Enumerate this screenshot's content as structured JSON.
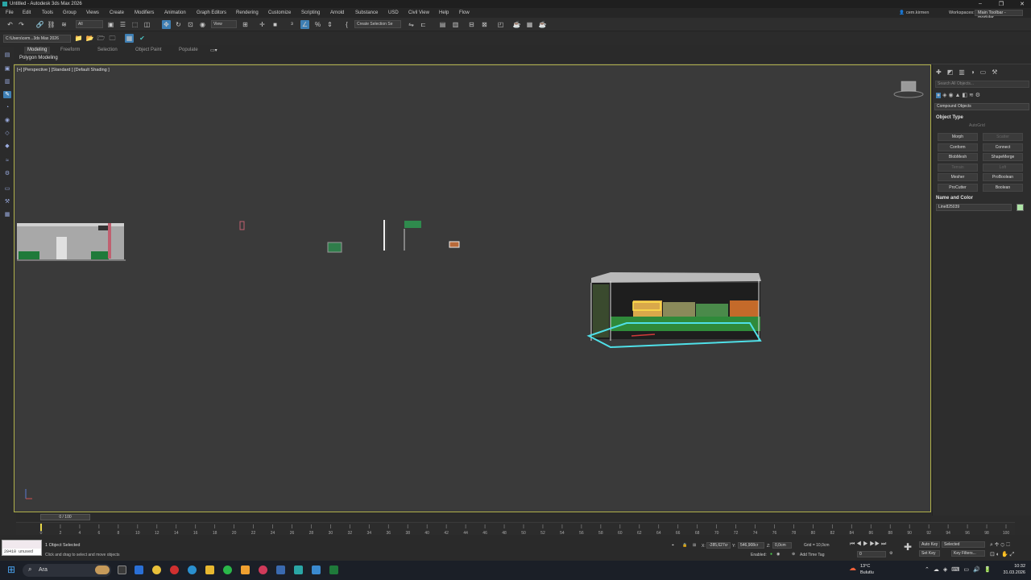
{
  "window": {
    "title": "Untitled - Autodesk 3ds Max 2026"
  },
  "menu": [
    "File",
    "Edit",
    "Tools",
    "Group",
    "Views",
    "Create",
    "Modifiers",
    "Animation",
    "Graph Editors",
    "Rendering",
    "Customize",
    "Scripting",
    "Arnold",
    "Substance",
    "USD",
    "Civil View",
    "Help",
    "Flow"
  ],
  "user": "cem.kirmen",
  "workspaces_label": "Workspaces:",
  "workspace_value": "Main Toolbar - modular",
  "toolbar": {
    "selection_filter": "All",
    "ref_coord": "View",
    "named_selection": "Create Selection Se"
  },
  "project_path": "C:\\Users\\cem...3ds Max 2026",
  "ribbon": {
    "tabs": [
      "Modeling",
      "Freeform",
      "Selection",
      "Object Paint",
      "Populate"
    ],
    "active_tab": "Modeling",
    "subpanel": "Polygon Modeling"
  },
  "viewport": {
    "label": "[+] [Perspective ] [Standard ] [Default Shading ]"
  },
  "command_panel": {
    "search_placeholder": "Search All Objects...",
    "category": "Compound Objects",
    "object_type_header": "Object Type",
    "autogrid": "AutoGrid",
    "buttons": [
      {
        "label": "Morph",
        "enabled": true
      },
      {
        "label": "Scatter",
        "enabled": false
      },
      {
        "label": "Conform",
        "enabled": true
      },
      {
        "label": "Connect",
        "enabled": true
      },
      {
        "label": "BlobMesh",
        "enabled": true
      },
      {
        "label": "ShapeMerge",
        "enabled": true
      },
      {
        "label": "Terrain",
        "enabled": false
      },
      {
        "label": "Loft",
        "enabled": false
      },
      {
        "label": "Mesher",
        "enabled": true
      },
      {
        "label": "ProBoolean",
        "enabled": true
      },
      {
        "label": "ProCutter",
        "enabled": true
      },
      {
        "label": "Boolean",
        "enabled": true
      }
    ],
    "name_color_header": "Name and Color",
    "object_name": "Line825039",
    "object_color": "#aee5a6"
  },
  "timeline": {
    "frame_display": "0 / 100",
    "ticks": [
      0,
      2,
      4,
      6,
      8,
      10,
      12,
      14,
      16,
      18,
      20,
      22,
      24,
      26,
      28,
      30,
      32,
      34,
      36,
      38,
      40,
      42,
      44,
      46,
      48,
      50,
      52,
      54,
      56,
      58,
      60,
      62,
      64,
      66,
      68,
      70,
      72,
      74,
      76,
      78,
      80,
      82,
      84,
      86,
      88,
      90,
      92,
      94,
      96,
      98,
      100
    ]
  },
  "status": {
    "maxscript_text": "20410 unused",
    "selected": "1 Object Selected",
    "prompt": "Click and drag to select and move objects",
    "x_label": "X:",
    "x_value": "-285,627cr",
    "y_label": "Y:",
    "y_value": "546,908cr",
    "z_label": "Z:",
    "z_value": "0,0cm",
    "grid": "Grid = 10,0cm",
    "enabled": "Enabled:",
    "add_time_tag": "Add Time Tag",
    "auto_key": "Auto Key",
    "set_key": "Set Key",
    "key_mode": "Selected",
    "key_filters": "Key Filters...",
    "frame": "0"
  },
  "taskbar": {
    "search": "Ara",
    "weather_temp": "13°C",
    "weather_desc": "Bulutlu",
    "time": "10:32",
    "date": "31.03.2026"
  }
}
